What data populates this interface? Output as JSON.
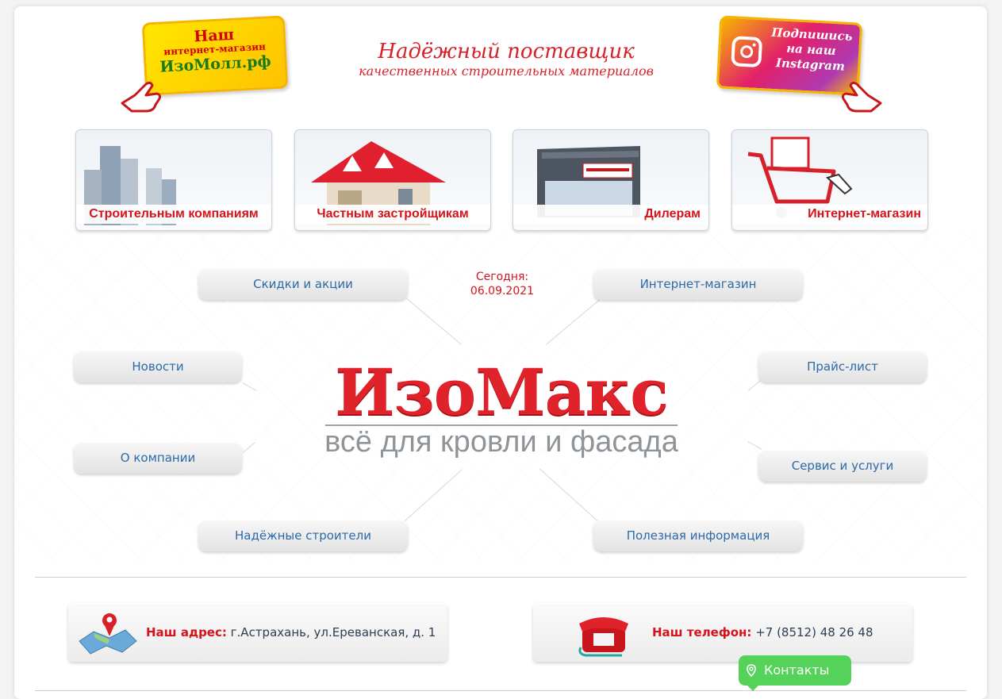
{
  "promo": {
    "shop_badge": {
      "line1": "Наш",
      "line2": "интернет-магазин",
      "line3": "ИзоМолл.рф"
    },
    "instagram_badge": {
      "line1": "Подпишись",
      "line2": "на наш",
      "line3": "Instagram"
    }
  },
  "tagline": {
    "line1": "Надёжный поставщик",
    "line2": "качественных строительных материалов"
  },
  "tiles": [
    {
      "label": "Строительным компаниям",
      "icon": "skyscraper-icon"
    },
    {
      "label": "Частным застройщикам",
      "icon": "house-icon"
    },
    {
      "label": "Дилерам",
      "icon": "store-icon"
    },
    {
      "label": "Интернет-магазин",
      "icon": "cart-icon"
    }
  ],
  "nav": {
    "discounts": "Скидки и акции",
    "shop": "Интернет-магазин",
    "news": "Новости",
    "pricelist": "Прайс-лист",
    "about": "О компании",
    "service": "Сервис и услуги",
    "builders": "Надёжные строители",
    "info": "Полезная информация"
  },
  "today": {
    "label": "Сегодня:",
    "date": "06.09.2021"
  },
  "logo": {
    "name": "ИзоМакс",
    "slogan": "всё для кровли и фасада"
  },
  "contacts": {
    "address_label": "Наш адрес:",
    "address": "г.Астрахань, ул.Ереванская, д. 1",
    "phone_label": "Наш телефон:",
    "phone": "+7 (8512) 48 26 48",
    "button_label": "Контакты"
  },
  "colors": {
    "accent_red": "#d4141a",
    "link_blue": "#2b6aa8",
    "contacts_green": "#55d25a"
  }
}
